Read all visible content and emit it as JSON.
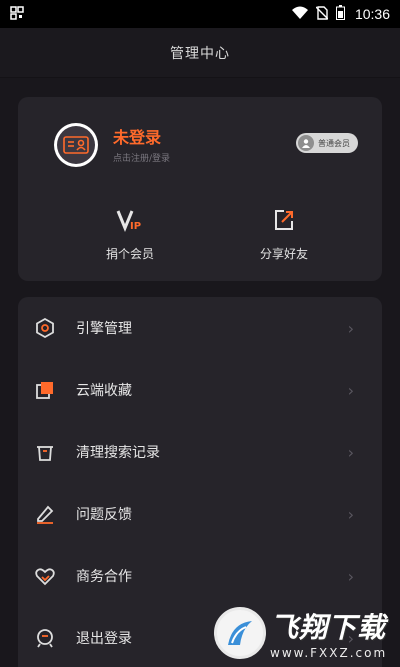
{
  "status_bar": {
    "time": "10:36",
    "icons": [
      "qr-icon",
      "wifi-icon",
      "no-sim-icon",
      "battery-icon"
    ]
  },
  "header": {
    "title": "管理中心"
  },
  "profile": {
    "title": "未登录",
    "subtitle": "点击注册/登录",
    "badge": "普通会员"
  },
  "actions": [
    {
      "label": "捐个会员",
      "icon": "vip-icon"
    },
    {
      "label": "分享好友",
      "icon": "share-icon"
    }
  ],
  "menu": [
    {
      "label": "引擎管理",
      "icon": "hexagon-gear-icon"
    },
    {
      "label": "云端收藏",
      "icon": "bookmark-stack-icon"
    },
    {
      "label": "清理搜索记录",
      "icon": "trash-icon"
    },
    {
      "label": "问题反馈",
      "icon": "pencil-icon"
    },
    {
      "label": "商务合作",
      "icon": "handshake-heart-icon"
    },
    {
      "label": "退出登录",
      "icon": "logout-icon"
    }
  ],
  "watermark": {
    "name": "飞翔下载",
    "url": "www.FXXZ.com"
  },
  "colors": {
    "accent": "#ff6a2b",
    "background": "#19171c",
    "card": "#26242a"
  }
}
